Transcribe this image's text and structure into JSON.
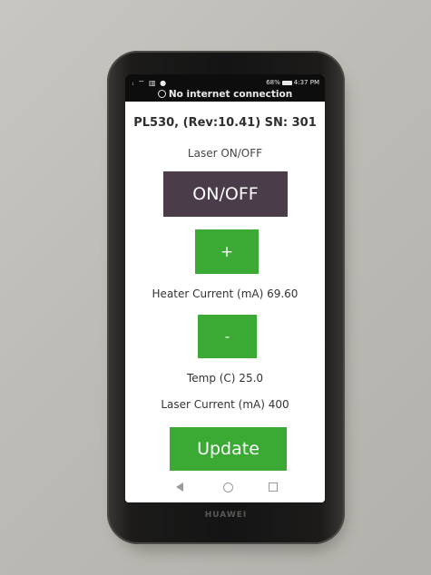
{
  "status_bar": {
    "signal": "ᵢ ⌔ ▥ ●",
    "battery": "68%",
    "time": "4:37 PM",
    "notice": "No internet connection"
  },
  "app": {
    "title": "PL530, (Rev:10.41) SN: 301",
    "laser_label": "Laser ON/OFF",
    "onoff_button": "ON/OFF",
    "plus_button": "+",
    "heater_current": "Heater Current (mA) 69.60",
    "minus_button": "-",
    "temp": "Temp (C) 25.0",
    "laser_current": "Laser Current (mA) 400",
    "update_button": "Update"
  },
  "colors": {
    "green": "#3aaa35",
    "dark_button": "#4a3c48"
  },
  "nav_icons": [
    "back-icon",
    "home-icon",
    "recents-icon"
  ],
  "brand": "HUAWEI"
}
